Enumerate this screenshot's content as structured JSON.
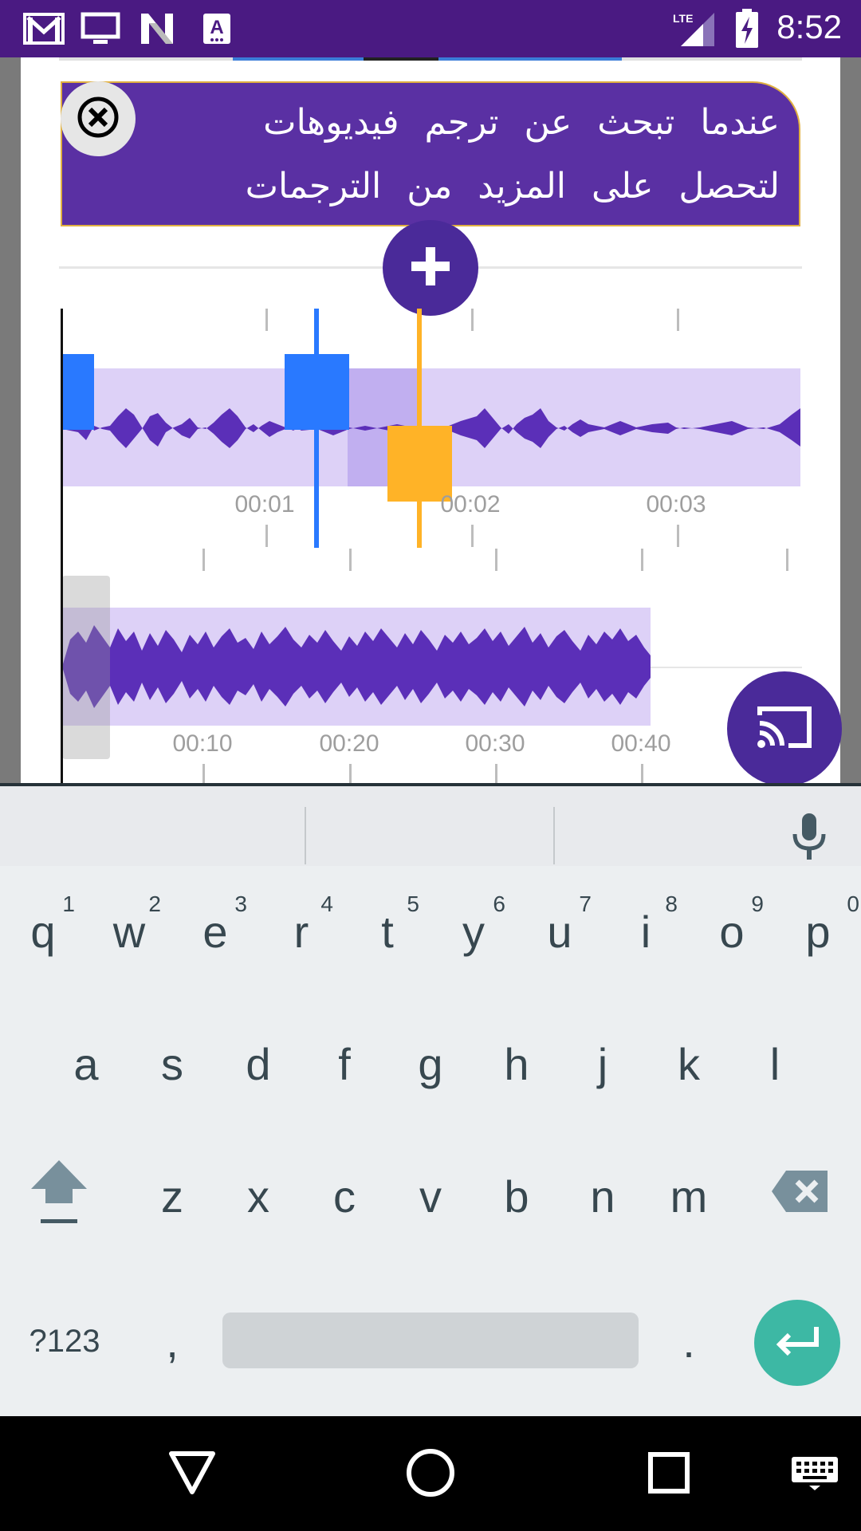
{
  "status_bar": {
    "time": "8:52",
    "network": "LTE",
    "icons": [
      "gmail-icon",
      "tv-icon",
      "n-icon",
      "font-a-icon",
      "signal-icon",
      "battery-charging-icon"
    ]
  },
  "subtitle": {
    "line1": "عندما تبحث عن ترجم فيديوهات",
    "line2": "لتحصل على المزيد من الترجمات"
  },
  "timeline_top": {
    "labels": [
      "00:01",
      "00:02",
      "00:03"
    ]
  },
  "timeline_bottom": {
    "labels": [
      "00:10",
      "00:20",
      "00:30",
      "00:40"
    ]
  },
  "keyboard": {
    "row1": [
      {
        "key": "q",
        "hint": "1"
      },
      {
        "key": "w",
        "hint": "2"
      },
      {
        "key": "e",
        "hint": "3"
      },
      {
        "key": "r",
        "hint": "4"
      },
      {
        "key": "t",
        "hint": "5"
      },
      {
        "key": "y",
        "hint": "6"
      },
      {
        "key": "u",
        "hint": "7"
      },
      {
        "key": "i",
        "hint": "8"
      },
      {
        "key": "o",
        "hint": "9"
      },
      {
        "key": "p",
        "hint": "0"
      }
    ],
    "row2": [
      "a",
      "s",
      "d",
      "f",
      "g",
      "h",
      "j",
      "k",
      "l"
    ],
    "row3": [
      "z",
      "x",
      "c",
      "v",
      "b",
      "n",
      "m"
    ],
    "symbols_label": "?123",
    "comma": ",",
    "period": "."
  },
  "colors": {
    "status_bar": "#4a1a82",
    "accent_purple": "#4a2a99",
    "marker_blue": "#2979ff",
    "marker_amber": "#ffb327",
    "enter_key": "#3db8a4"
  }
}
